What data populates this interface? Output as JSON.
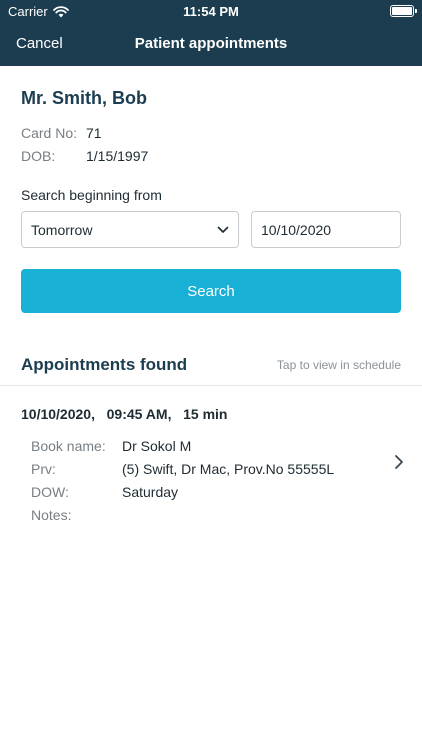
{
  "status_bar": {
    "carrier": "Carrier",
    "time": "11:54 PM"
  },
  "nav": {
    "cancel_label": "Cancel",
    "title": "Patient appointments"
  },
  "patient": {
    "name": "Mr. Smith, Bob",
    "card_label": "Card No:",
    "card_value": "71",
    "dob_label": "DOB:",
    "dob_value": "1/15/1997"
  },
  "search": {
    "label": "Search beginning from",
    "range_value": "Tomorrow",
    "date_value": "10/10/2020",
    "button_label": "Search"
  },
  "results": {
    "title": "Appointments found",
    "hint": "Tap to view in schedule",
    "items": [
      {
        "header": "10/10/2020,   09:45 AM,   15 min",
        "book_label": "Book name:",
        "book_value": "Dr Sokol M",
        "prv_label": "Prv:",
        "prv_value": "(5) Swift, Dr Mac, Prov.No 55555L",
        "dow_label": "DOW:",
        "dow_value": "Saturday",
        "notes_label": "Notes:",
        "notes_value": ""
      }
    ]
  },
  "colors": {
    "header_bg": "#1c3d4f",
    "accent": "#19b0d6",
    "heading": "#1c3d4f"
  },
  "icons": [
    "wifi-icon",
    "battery-icon",
    "chevron-down-icon",
    "chevron-right-icon"
  ]
}
